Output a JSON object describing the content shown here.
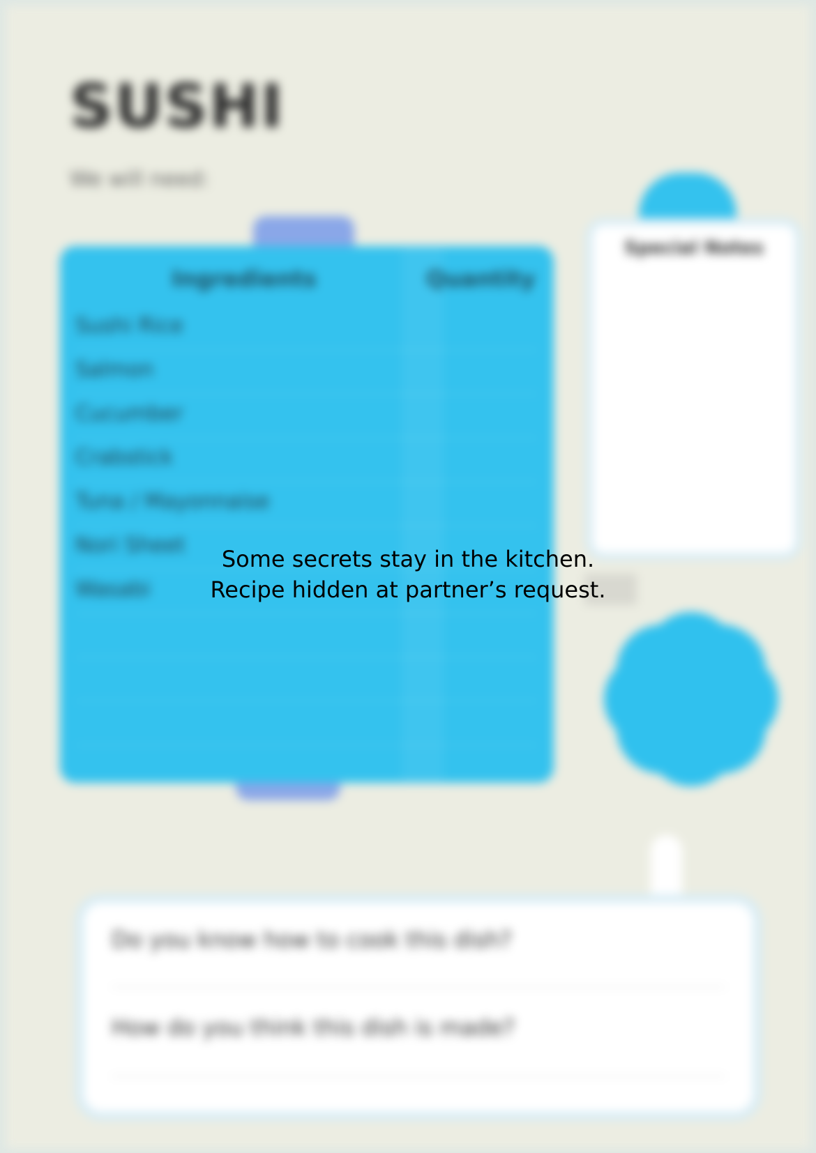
{
  "recipe": {
    "title": "SUSHI",
    "subtitle": "We will need:"
  },
  "ingredients_table": {
    "headers": {
      "ingredients": "Ingredients",
      "quantity": "Quantity"
    },
    "rows": [
      {
        "label": "Sushi Rice"
      },
      {
        "label": "Salmon"
      },
      {
        "label": "Cucumber"
      },
      {
        "label": "Crabstick"
      },
      {
        "label": "Tuna / Mayonnaise"
      },
      {
        "label": "Nori Sheet"
      },
      {
        "label": "Wasabi"
      },
      {
        "label": ""
      },
      {
        "label": ""
      },
      {
        "label": ""
      }
    ]
  },
  "notes": {
    "title": "Special Notes"
  },
  "questions": [
    "Do you know how to cook this dish?",
    "How do you think this dish is made?"
  ],
  "notice": {
    "line1": "Some secrets stay in the kitchen.",
    "line2": "Recipe hidden at partner’s request."
  },
  "colors": {
    "background": "#ecede2",
    "accent_blue": "#34c2ee",
    "tab_purple": "#8aa7e8",
    "card_white": "#ffffff"
  }
}
